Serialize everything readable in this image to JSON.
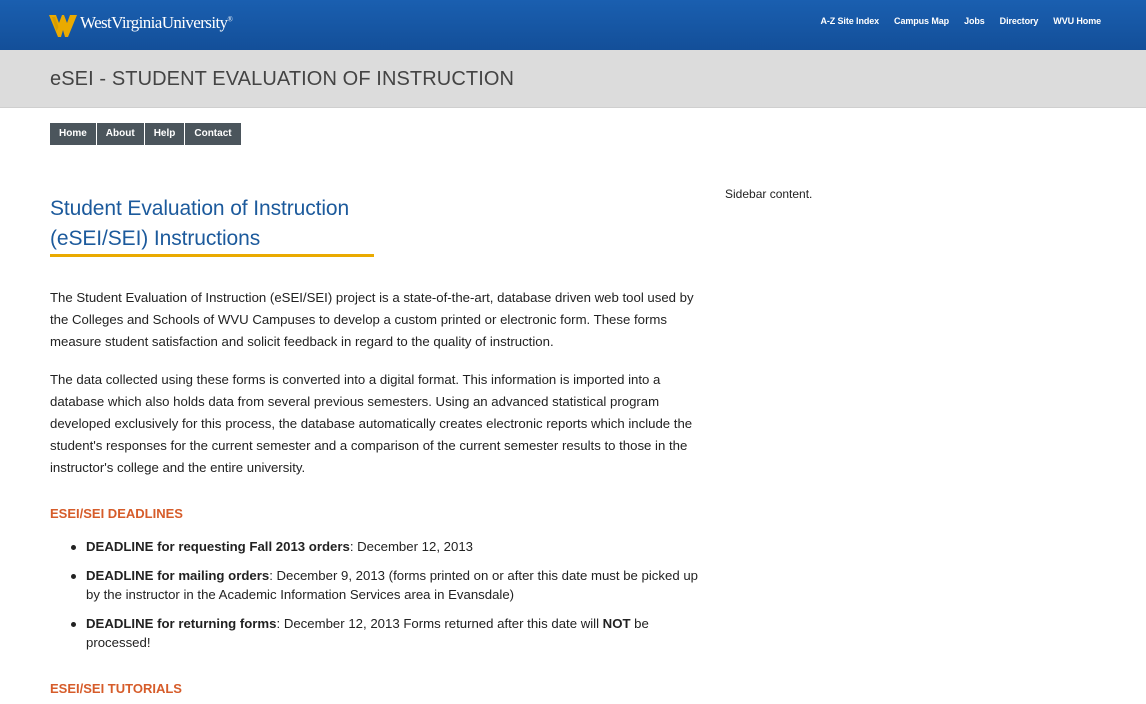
{
  "header": {
    "logo_text": "WestVirginiaUniversity",
    "logo_mark": "®",
    "links": [
      "A-Z Site Index",
      "Campus Map",
      "Jobs",
      "Directory",
      "WVU Home"
    ]
  },
  "site": {
    "title": "eSEI - STUDENT EVALUATION OF INSTRUCTION"
  },
  "nav": [
    "Home",
    "About",
    "Help",
    "Contact"
  ],
  "sidebar": {
    "text": "Sidebar content."
  },
  "main": {
    "heading_line1": "Student Evaluation of Instruction",
    "heading_line2": "(eSEI/SEI) Instructions",
    "paragraph1": "The Student Evaluation of Instruction (eSEI/SEI) project is a state-of-the-art, database driven web tool used by the Colleges and Schools of WVU Campuses to develop a custom printed or electronic form. These forms measure student satisfaction and solicit feedback in regard to the quality of instruction.",
    "paragraph2": "The data collected using these forms is converted into a digital format. This information is imported into a database which also holds data from several previous semesters. Using an advanced statistical program developed exclusively for this process, the database automatically creates electronic reports which include the student's responses for the current semester and a comparison of the current semester results to those in the instructor's college and the entire university.",
    "deadlines_heading": "ESEI/SEI DEADLINES",
    "deadlines": [
      {
        "label": "DEADLINE for requesting Fall 2013 orders",
        "text": ": December 12, 2013"
      },
      {
        "label": "DEADLINE for mailing orders",
        "text": ": December 9, 2013 (forms printed on or after this date must be picked up by the instructor in the Academic Information Services area in Evansdale)"
      },
      {
        "label": "DEADLINE for returning forms",
        "text": ": December 12, 2013 Forms returned after this date will ",
        "strong": "NOT",
        "tail": " be processed!"
      }
    ],
    "tutorials_heading": "ESEI/SEI TUTORIALS"
  },
  "colors": {
    "topbar": "#1a5fb0",
    "title_band": "#dcdcdc",
    "nav_bg": "#4b555c",
    "heading_blue": "#1c5a9c",
    "underline_gold": "#eaaa00",
    "section_orange": "#d65c2a"
  },
  "icons": {
    "logo": "wvu-flying-wv-icon"
  }
}
